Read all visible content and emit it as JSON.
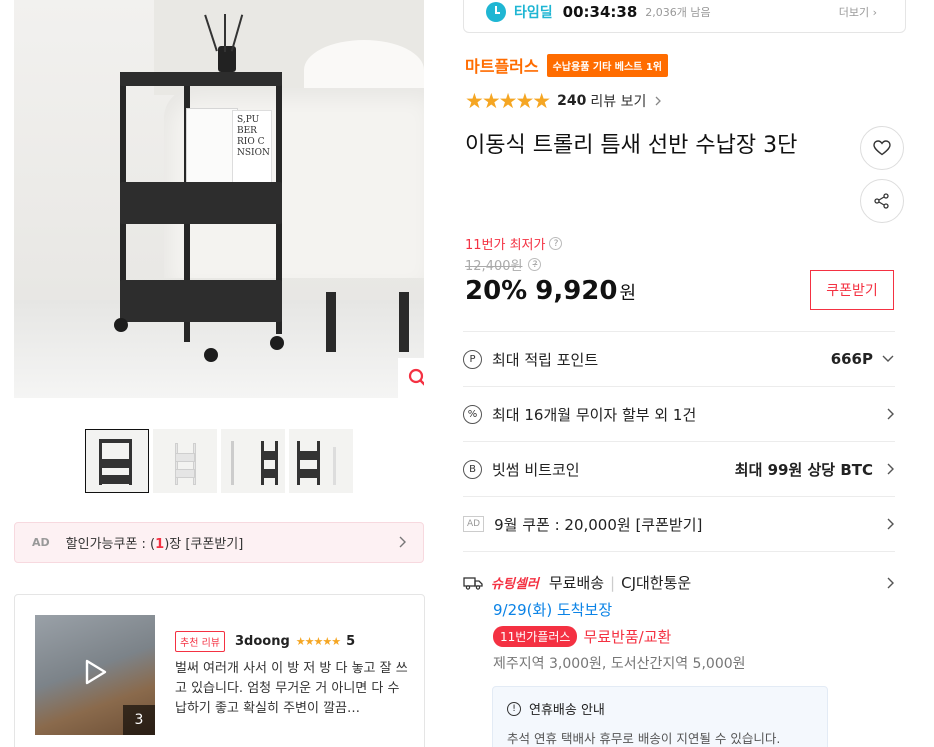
{
  "gallery": {
    "thumbnail_count": 4,
    "book_lines": [
      "S,PU",
      "BER",
      "RIO C",
      "NSION"
    ]
  },
  "ad_coupon": {
    "ad_tag": "AD",
    "prefix": "할인가능쿠폰 : (",
    "count": "1",
    "suffix": ")장 [쿠폰받기]"
  },
  "review": {
    "badge": "추천 리뷰",
    "user": "3doong",
    "stars": "★★★★★",
    "score": "5",
    "media_count": "3",
    "text": "벌써 여러개 사서 이 방 저 방 다 놓고 잘 쓰고 있습니다. 엄청 무거운 거 아니면 다 수납하기 좋고 확실히 주변이 깔끔…"
  },
  "timedeal": {
    "label": "타임딜",
    "timer": "00:34:38",
    "remaining": "2,036개 남음",
    "more": "더보기 ›"
  },
  "store": {
    "name": "마트플러스",
    "best_badge": "수납용품 기타 베스트 1위"
  },
  "rating": {
    "stars": "★★★★★",
    "value": 4.5,
    "count": "240",
    "link": "리뷰 보기"
  },
  "product": {
    "title": "이동식 트롤리 틈새 선반 수납장 3단"
  },
  "price": {
    "lowest_label": "11번가 최저가",
    "original": "12,400원",
    "discount": "20%",
    "final": "9,920",
    "currency": "원",
    "coupon_button": "쿠폰받기"
  },
  "benefits": [
    {
      "icon": "P",
      "label": "최대 적립 포인트",
      "right": "666P"
    },
    {
      "icon": "%",
      "label": "최대 16개월 무이자 할부 외 1건",
      "right": ""
    },
    {
      "icon": "B",
      "label": "빗썸 비트코인",
      "right": "최대 99원 상당 BTC"
    },
    {
      "icon": "AD",
      "label": "9월 쿠폰 : 20,000원 [쿠폰받기]",
      "right": ""
    }
  ],
  "delivery": {
    "brand": "슈팅셀러",
    "shipping": "무료배송",
    "carrier": "CJ대한통운",
    "arrival": "9/29(화) 도착보장",
    "plus_badge": "11번가플러스",
    "plus_text": "무료반품/교환",
    "extra_fee": "제주지역 3,000원, 도서산간지역 5,000원"
  },
  "notice": {
    "title": "연휴배송 안내",
    "body": "추석 연휴 택배사 휴무로 배송이 지연될 수 있습니다."
  },
  "colors": {
    "accent_red": "#f43142",
    "store_orange": "#ff6c00",
    "timedeal_blue": "#1fb6d3",
    "date_blue": "#0b83e6",
    "star_gold": "#f5a623"
  }
}
